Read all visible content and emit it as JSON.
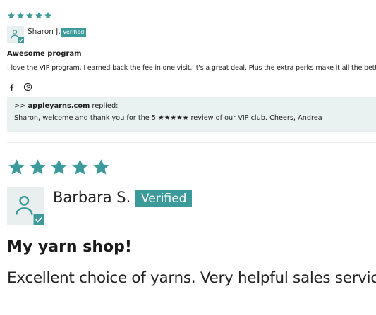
{
  "colors": {
    "accent": "#3d9a9a",
    "reply_bg": "#eaf1f1",
    "avatar_bg": "#e9eeef"
  },
  "review1": {
    "rating": 5,
    "author": "Sharon J.",
    "badge": "Verified",
    "title": "Awesome program",
    "body": "I love the VIP program, I earned back the fee in one visit. It's a great deal. Plus the extra perks make it all the better",
    "share_icons": [
      "facebook-icon",
      "pinterest-icon"
    ],
    "reply": {
      "prefix": ">>",
      "store": "appleyarns.com",
      "suffix": "replied:",
      "text": "Sharon, welcome and thank you for the 5 ★★★★★ review of our VIP club. Cheers, Andrea"
    }
  },
  "review2": {
    "rating": 5,
    "author": "Barbara S.",
    "badge": "Verified",
    "title": "My yarn shop!",
    "body": "Excellent choice of yarns. Very helpful sales service."
  }
}
